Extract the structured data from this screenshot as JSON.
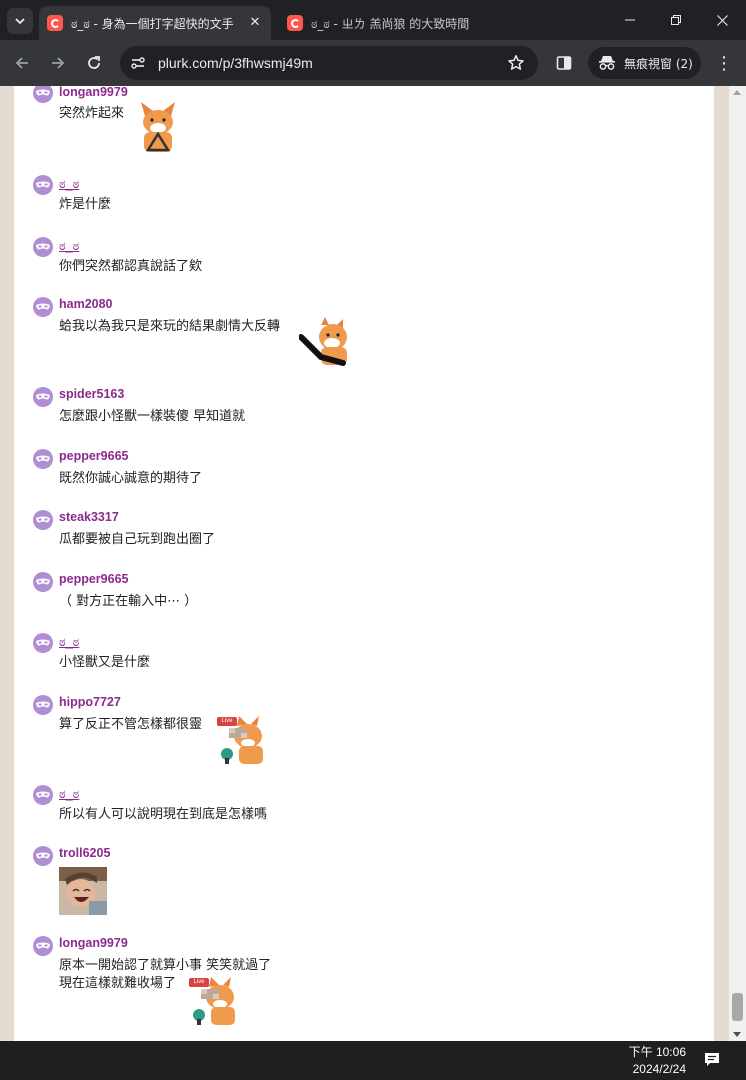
{
  "browser": {
    "tabs": [
      {
        "title": "ಠ_ಠ - 身為一個打字超快的文手",
        "close": "✕",
        "active": true
      },
      {
        "title": "ಠ_ಠ - ㄓㄌ 羔尚狼 的大致時間",
        "active": false
      }
    ],
    "url": "plurk.com/p/3fhwsmj49m",
    "incognito_label": "無痕視窗 (2)",
    "menu_glyph": "⋮"
  },
  "responses": [
    {
      "user": "longan9979",
      "text": "突然炸起來",
      "sticker": "fox-triangle"
    },
    {
      "user": "ಠ_ಠ",
      "text": "炸是什麼",
      "is_link": true
    },
    {
      "user": "ಠ_ಠ",
      "text": "你們突然都認真說話了欸",
      "is_link": true
    },
    {
      "user": "ham2080",
      "text": "蛤我以為我只是來玩的結果劇情大反轉",
      "sticker": "fox-wave"
    },
    {
      "user": "spider5163",
      "text": "怎麼跟小怪獸一樣裝傻 早知道就"
    },
    {
      "user": "pepper9665",
      "text": "既然你誠心誠意的期待了"
    },
    {
      "user": "steak3317",
      "text": "瓜都要被自己玩到跑出圈了"
    },
    {
      "user": "pepper9665",
      "text": "（ 對方正在輸入中⋯ ）"
    },
    {
      "user": "ಠ_ಠ",
      "text": "小怪獸又是什麼",
      "is_link": true
    },
    {
      "user": "hippo7727",
      "text": "算了反正不管怎樣都很靈",
      "sticker": "fox-live",
      "badge": "Live"
    },
    {
      "user": "ಠ_ಠ",
      "text": "所以有人可以說明現在到底是怎樣嗎",
      "is_link": true
    },
    {
      "user": "troll6205",
      "text": "",
      "image": "laughing-photo"
    },
    {
      "user": "longan9979",
      "text": "原本一開始認了就算小事 笑笑就過了",
      "text2": "現在這樣就難收場了",
      "sticker": "fox-live",
      "badge": "Live"
    }
  ],
  "taskbar": {
    "time": "下午 10:06",
    "date": "2024/2/24"
  },
  "colors": {
    "username": "#8c2a8d",
    "avatar": "#b18dd4",
    "page_bg": "#e4dcd1"
  }
}
